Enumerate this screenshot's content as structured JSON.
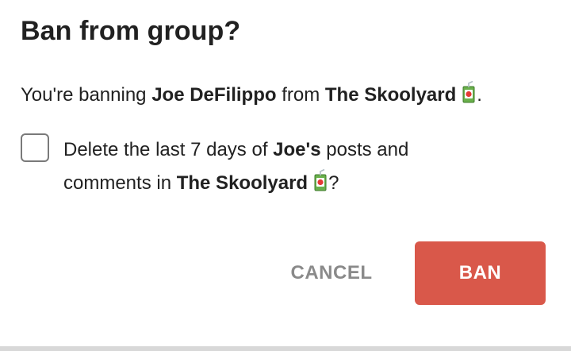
{
  "dialog": {
    "title": "Ban from group?",
    "message": {
      "prefix": "You're banning ",
      "user_name": "Joe DeFilippo",
      "middle": " from ",
      "group_name": "The Skoolyard",
      "emoji_icon": "juice-box-icon",
      "suffix": "."
    },
    "option": {
      "checked": false,
      "line1_prefix": "Delete the last 7 days of ",
      "user_possessive": "Joe's",
      "line1_suffix": " posts and",
      "line2_prefix": "comments in ",
      "group_name": "The Skoolyard",
      "emoji_icon": "juice-box-icon",
      "line2_suffix": "?"
    },
    "buttons": {
      "cancel_label": "CANCEL",
      "ban_label": "BAN"
    }
  },
  "colors": {
    "ban_button": "#d9584a",
    "cancel_text": "#8a8a8a",
    "text": "#212121"
  }
}
